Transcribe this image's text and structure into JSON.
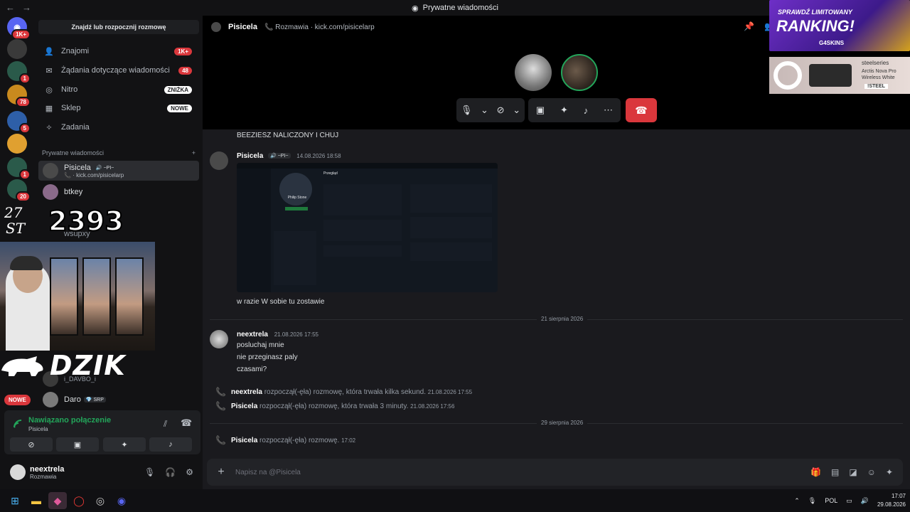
{
  "window": {
    "title": "Prywatne wiadomości"
  },
  "guilds": [
    {
      "name": "discord-home",
      "badge": "1K+",
      "color": "#5865f2"
    },
    {
      "name": "server-1",
      "badge": "",
      "color": "#3a3a3a"
    },
    {
      "name": "server-2",
      "badge": "1",
      "color": "#2a5a4a"
    },
    {
      "name": "server-3",
      "badge": "78",
      "color": "#c98a1e"
    },
    {
      "name": "server-4",
      "badge": "5",
      "color": "#2e5fa8"
    },
    {
      "name": "server-5",
      "badge": "",
      "color": "#e0a030"
    },
    {
      "name": "server-6",
      "badge": "1",
      "color": "#2a5a4a"
    },
    {
      "name": "server-7",
      "badge": "20",
      "color": "#2a5a4a"
    }
  ],
  "sidebar": {
    "search": "Znajdź lub rozpocznij rozmowę",
    "nav": [
      {
        "label": "Znajomi",
        "badge": "1K+",
        "badge_style": "red",
        "icon": "👤"
      },
      {
        "label": "Żądania dotyczące wiadomości",
        "badge": "48",
        "badge_style": "red",
        "icon": "✉"
      },
      {
        "label": "Nitro",
        "badge": "ZNIŻKA",
        "badge_style": "white",
        "icon": "◎"
      },
      {
        "label": "Sklep",
        "badge": "NOWE",
        "badge_style": "white",
        "icon": "▦"
      },
      {
        "label": "Zadania",
        "badge": "",
        "badge_style": "",
        "icon": "✧"
      }
    ],
    "section_title": "Prywatne wiadomości",
    "section_add": "+",
    "dms": [
      {
        "name": "Pisicela",
        "tag": "🔊 ~PI~",
        "sub": "📞 · kick.com/pisicelarp"
      },
      {
        "name": "btkey",
        "tag": "",
        "sub": ""
      },
      {
        "name": "wsupxy",
        "tag": "",
        "sub": ""
      },
      {
        "name": "i_DAVBO_i",
        "tag": "",
        "sub": ""
      },
      {
        "name": "Daro",
        "tag": "💎 SRP",
        "sub": ""
      }
    ],
    "new_badge": "NOWE"
  },
  "overlay": {
    "counter": "2393",
    "brand": "DZIK"
  },
  "voice": {
    "status": "Nawiązano połączenie",
    "channel": "Pisicela"
  },
  "user": {
    "name": "neextrela",
    "status": "Rozmawia"
  },
  "chat": {
    "header_name": "Pisicela",
    "header_status": "Rozmawia",
    "header_link": "· kick.com/pisicelarp",
    "messages": {
      "m0": "BEEZIESZ NALICZONY I CHUJ",
      "pis_name": "Pisicela",
      "pis_tag": "🔊 ~PI~",
      "pis_time": "14.08.2026 18:58",
      "m1": "w razie W sobie tu zostawie",
      "div1": "21 sierpnia 2026",
      "nee_name": "neextrela",
      "nee_time": "21.08.2026 17:55",
      "m2": "posluchaj mnie",
      "m3": "nie przeginasz paly",
      "m4": "czasami?",
      "s1_user": "neextrela",
      "s1_text": "rozpoczął(-ęła) rozmowę, która trwała kilka sekund.",
      "s1_time": "21.08.2026 17:55",
      "s2_user": "Pisicela",
      "s2_text": "rozpoczął(-ęła) rozmowę, która trwała 3 minuty.",
      "s2_time": "21.08.2026 17:56",
      "div2": "29 sierpnia 2026",
      "s3_user": "Pisicela",
      "s3_text": "rozpoczął(-ęła) rozmowę.",
      "s3_time": "17:02"
    },
    "embed": {
      "profile_name": "Philip Stone",
      "panel_title": "Przegląd"
    },
    "composer_placeholder": "Napisz na @Pisicela"
  },
  "ads": {
    "top_line": "SPRAWDŹ LIMITOWANY",
    "headline": "RANKING!",
    "brand": "G4SKINS",
    "ad2_brand": "steelseries",
    "ad2_product": "Arctis Nova Pro Wireless White",
    "ad2_code": "!STEEL"
  },
  "taskbar": {
    "lang": "POL",
    "time": "17:07",
    "date": "29.08.2026"
  },
  "colors": {
    "accent": "#5865f2",
    "danger": "#da373c",
    "online": "#23a55a"
  }
}
